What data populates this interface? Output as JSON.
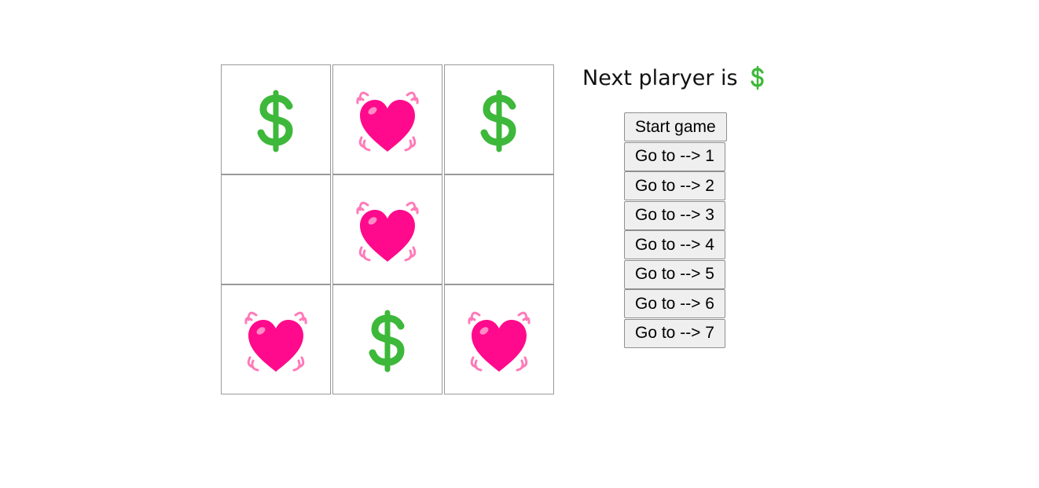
{
  "game": {
    "board": [
      "$",
      "heart",
      "$",
      "",
      "heart",
      "",
      "heart",
      "$",
      "heart"
    ]
  },
  "status": {
    "text": "Next plaryer is",
    "next_player": "$"
  },
  "history": {
    "buttons": [
      "Start game",
      "Go to --> 1",
      "Go to --> 2",
      "Go to --> 3",
      "Go to --> 4",
      "Go to --> 5",
      "Go to --> 6",
      "Go to --> 7"
    ]
  },
  "colors": {
    "dollar": "#3db83a",
    "heart": "#ff0a8c",
    "heart_waves": "#ff7ab8",
    "cell_border": "#999999",
    "button_bg": "#efefef"
  },
  "icons": {
    "dollar": "heavy-dollar-sign-icon",
    "heart": "beating-heart-icon"
  }
}
